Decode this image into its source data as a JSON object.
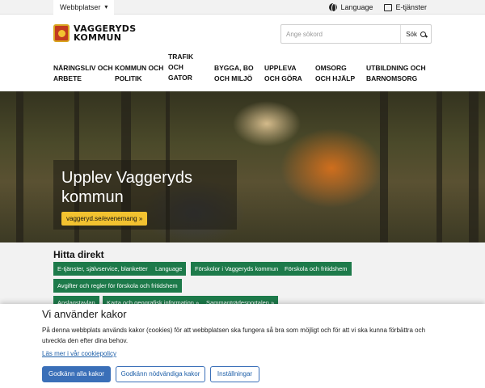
{
  "topbar": {
    "site_select": "Webbplatser",
    "language": "Language",
    "eservices": "E-tjänster"
  },
  "header": {
    "logo_line1": "VAGGERYDS",
    "logo_line2": "KOMMUN",
    "search_placeholder": "Ange sökord",
    "search_button": "Sök"
  },
  "nav": {
    "items": [
      "Näringsliv och\narbete",
      "Kommun och\npolitik",
      "Trafik\noch\ngator",
      "Bygga, bo\noch miljö",
      "Uppleva\noch göra",
      "Omsorg\noch hjälp",
      "Utbildning och\nbarnomsorg"
    ]
  },
  "hero": {
    "title": "Upplev Vaggeryds kommun",
    "cta": "vaggeryd.se/evenemang »"
  },
  "quick": {
    "heading": "Hitta direkt",
    "links": [
      "E-tjänster, självservice, blanketter",
      "Language",
      "Förskolor i Vaggeryds kommun",
      "Förskola och fritidshem",
      "Avgifter och regler för förskola och fritidshem",
      "Anslagstavlan",
      "Karta och geografisk information »",
      "Sammanträdesportalen »"
    ]
  },
  "cookie": {
    "title": "Vi använder kakor",
    "text": "På denna webbplats används kakor (cookies) för att webbplatsen ska fungera så bra som möjligt och för att vi ska kunna förbättra och utveckla den efter dina behov.",
    "policy_link": "Läs mer i vår cookiepolicy",
    "accept_all": "Godkänn alla kakor",
    "accept_necessary": "Godkänn nödvändiga kakor",
    "settings": "Inställningar"
  },
  "colors": {
    "accent_green": "#1d7a4a",
    "cta_yellow": "#f2c230",
    "button_blue": "#3a6fb8"
  }
}
